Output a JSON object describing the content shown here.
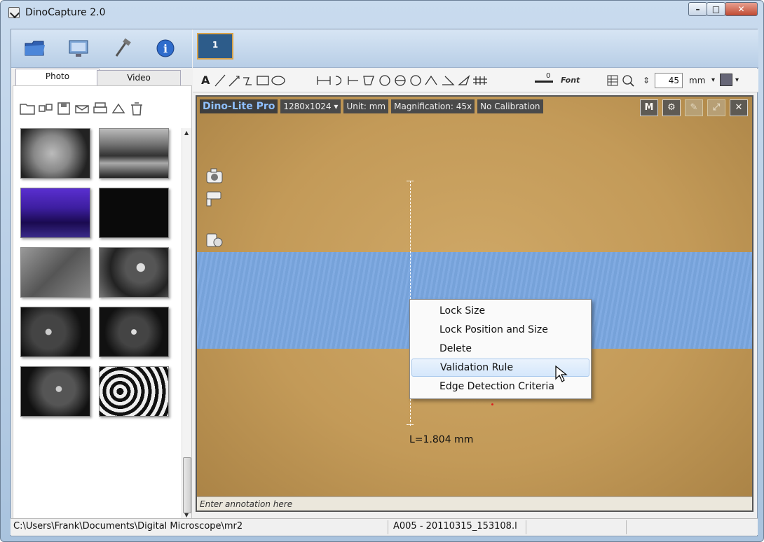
{
  "window": {
    "title": "DinoCapture 2.0"
  },
  "window_buttons": {
    "minimize": "–",
    "maximize": "□",
    "close": "✕"
  },
  "layout_button": {
    "label": "1"
  },
  "tabs": [
    {
      "label": "Photo"
    },
    {
      "label": "Video"
    }
  ],
  "toolbar": {
    "line_width_value": "0",
    "font_label": "Font",
    "zoom_value": "45",
    "unit_label": "mm"
  },
  "viewer": {
    "brand": "Dino-Lite Pro",
    "resolution": "1280x1024",
    "unit": "Unit: mm",
    "magnification": "Magnification:  45x",
    "calibration": "No Calibration",
    "measurement_label": "L=1.804 mm",
    "annotation_placeholder": "Enter annotation here"
  },
  "context_menu": {
    "items": [
      {
        "label": "Lock Size"
      },
      {
        "label": "Lock Position and Size"
      },
      {
        "label": "Delete"
      },
      {
        "label": "Validation Rule"
      },
      {
        "label": "Edge Detection Criteria"
      }
    ]
  },
  "status_bar": {
    "path": "C:\\Users\\Frank\\Documents\\Digital Microscope\\mr2",
    "file": "A005 - 20110315_153108.l"
  },
  "colors": {
    "band": "#7aa7e0",
    "sample": "#c39a58",
    "accent": "#2d5c8a"
  }
}
